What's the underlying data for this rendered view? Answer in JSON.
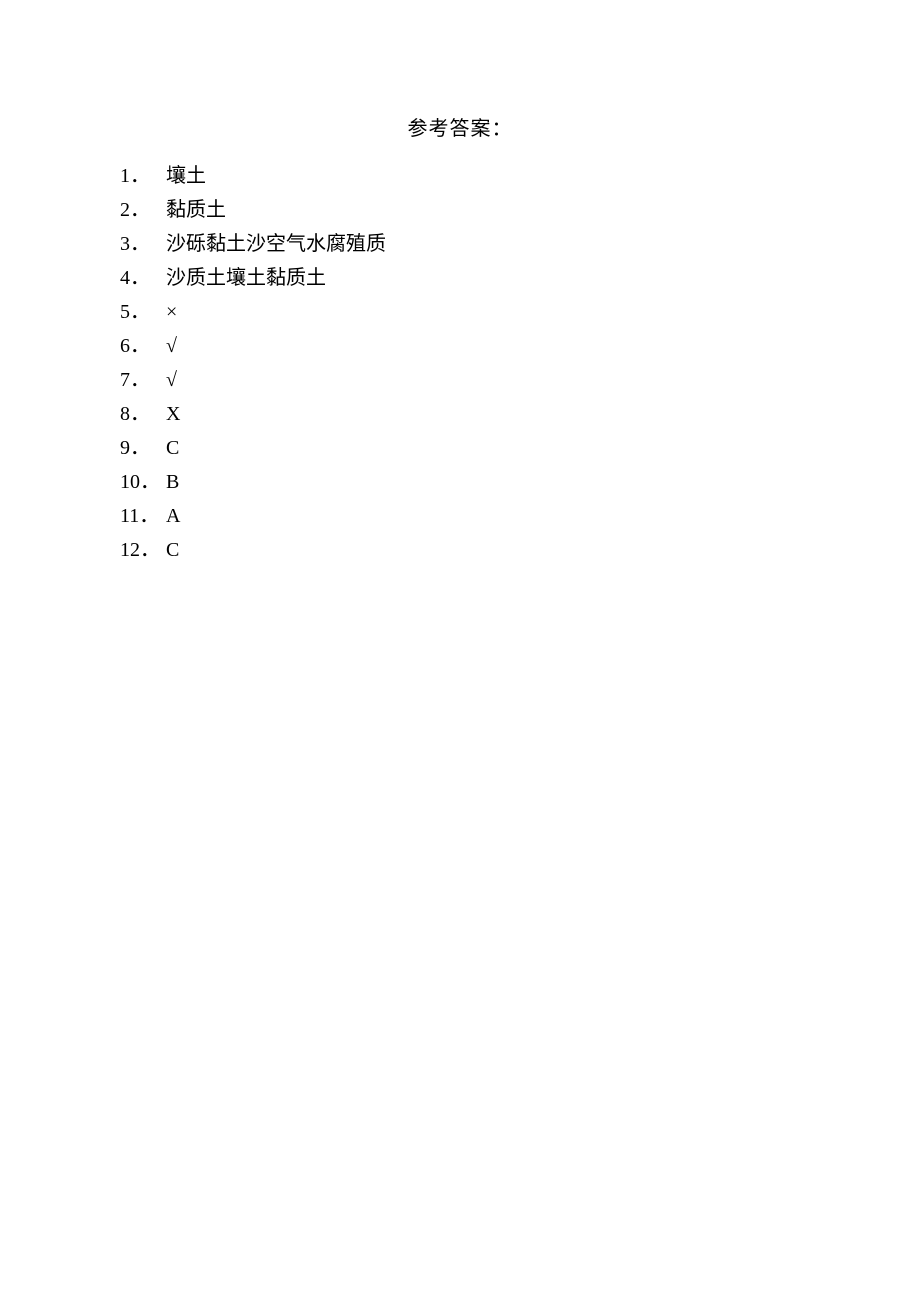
{
  "title": "参考答案：",
  "answers": [
    {
      "num": "1．",
      "text": "壤土"
    },
    {
      "num": "2．",
      "text": " 黏质土"
    },
    {
      "num": "3．",
      "text": " 沙砾黏土沙空气水腐殖质"
    },
    {
      "num": "4．",
      "text": " 沙质土壤土黏质土"
    },
    {
      "num": "5．",
      "text": "×"
    },
    {
      "num": "6．",
      "text": "√"
    },
    {
      "num": "7．",
      "text": "√"
    },
    {
      "num": "8．",
      "text": "X"
    },
    {
      "num": "9．",
      "text": "C"
    },
    {
      "num": "10．",
      "text": "B"
    },
    {
      "num": "11．",
      "text": "A"
    },
    {
      "num": "12．",
      "text": "C"
    }
  ]
}
